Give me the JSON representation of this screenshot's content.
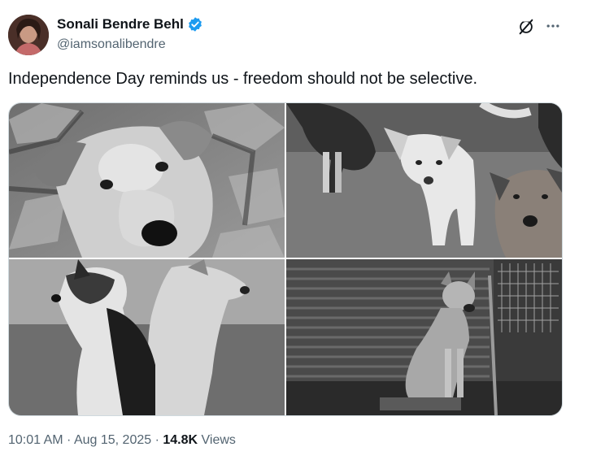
{
  "author": {
    "display_name": "Sonali Bendre Behl",
    "handle": "@iamsonalibendre",
    "verified": true,
    "verified_color": "#1d9bf0"
  },
  "icons": {
    "grok": "grok-icon",
    "more": "more-options-icon",
    "verified": "verified-badge-icon"
  },
  "tweet": {
    "text": "Independence Day reminds us - freedom should not be selective."
  },
  "media": {
    "count": 4,
    "images": [
      "dog-closeup-photo",
      "three-dogs-street-photo",
      "two-puppies-photo",
      "dog-sitting-by-shutter-photo"
    ]
  },
  "meta": {
    "time": "10:01 AM",
    "sep1": " · ",
    "date": "Aug 15, 2025",
    "sep2": " · ",
    "views_count": "14.8K",
    "views_label": " Views"
  }
}
